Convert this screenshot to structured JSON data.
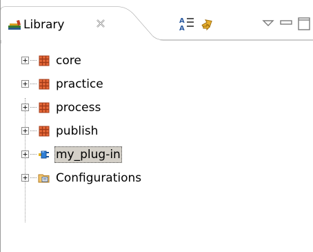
{
  "tab": {
    "label": "Library",
    "icon": "library-books-icon",
    "close_icon": "close-icon"
  },
  "toolbar": {
    "buttons": [
      {
        "icon": "hierarchy-layout-icon"
      },
      {
        "icon": "link-with-editor-icon"
      },
      {
        "icon": "view-menu-icon"
      },
      {
        "icon": "minimize-icon"
      },
      {
        "icon": "maximize-icon"
      }
    ]
  },
  "tree": {
    "items": [
      {
        "label": "core",
        "icon": "package-icon",
        "expanded": false,
        "selected": false
      },
      {
        "label": "practice",
        "icon": "package-icon",
        "expanded": false,
        "selected": false
      },
      {
        "label": "process",
        "icon": "package-icon",
        "expanded": false,
        "selected": false
      },
      {
        "label": "publish",
        "icon": "package-icon",
        "expanded": false,
        "selected": false
      },
      {
        "label": "my_plug-in",
        "icon": "plugin-icon",
        "expanded": false,
        "selected": true
      },
      {
        "label": "Configurations",
        "icon": "configuration-folder-icon",
        "expanded": false,
        "selected": false
      }
    ]
  },
  "colors": {
    "package": "#c0502a",
    "plugin": "#2f7fd6",
    "folder": "#e8a33c",
    "selection": "#d4d0c8"
  }
}
